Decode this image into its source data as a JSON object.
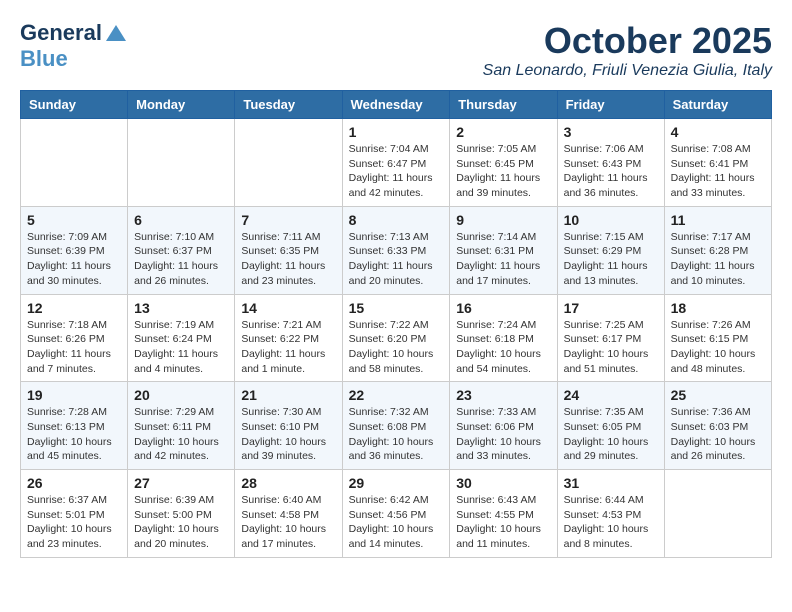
{
  "header": {
    "logo_general": "General",
    "logo_blue": "Blue",
    "month_title": "October 2025",
    "location": "San Leonardo, Friuli Venezia Giulia, Italy"
  },
  "days_of_week": [
    "Sunday",
    "Monday",
    "Tuesday",
    "Wednesday",
    "Thursday",
    "Friday",
    "Saturday"
  ],
  "weeks": [
    [
      {
        "day": "",
        "info": ""
      },
      {
        "day": "",
        "info": ""
      },
      {
        "day": "",
        "info": ""
      },
      {
        "day": "1",
        "info": "Sunrise: 7:04 AM\nSunset: 6:47 PM\nDaylight: 11 hours and 42 minutes."
      },
      {
        "day": "2",
        "info": "Sunrise: 7:05 AM\nSunset: 6:45 PM\nDaylight: 11 hours and 39 minutes."
      },
      {
        "day": "3",
        "info": "Sunrise: 7:06 AM\nSunset: 6:43 PM\nDaylight: 11 hours and 36 minutes."
      },
      {
        "day": "4",
        "info": "Sunrise: 7:08 AM\nSunset: 6:41 PM\nDaylight: 11 hours and 33 minutes."
      }
    ],
    [
      {
        "day": "5",
        "info": "Sunrise: 7:09 AM\nSunset: 6:39 PM\nDaylight: 11 hours and 30 minutes."
      },
      {
        "day": "6",
        "info": "Sunrise: 7:10 AM\nSunset: 6:37 PM\nDaylight: 11 hours and 26 minutes."
      },
      {
        "day": "7",
        "info": "Sunrise: 7:11 AM\nSunset: 6:35 PM\nDaylight: 11 hours and 23 minutes."
      },
      {
        "day": "8",
        "info": "Sunrise: 7:13 AM\nSunset: 6:33 PM\nDaylight: 11 hours and 20 minutes."
      },
      {
        "day": "9",
        "info": "Sunrise: 7:14 AM\nSunset: 6:31 PM\nDaylight: 11 hours and 17 minutes."
      },
      {
        "day": "10",
        "info": "Sunrise: 7:15 AM\nSunset: 6:29 PM\nDaylight: 11 hours and 13 minutes."
      },
      {
        "day": "11",
        "info": "Sunrise: 7:17 AM\nSunset: 6:28 PM\nDaylight: 11 hours and 10 minutes."
      }
    ],
    [
      {
        "day": "12",
        "info": "Sunrise: 7:18 AM\nSunset: 6:26 PM\nDaylight: 11 hours and 7 minutes."
      },
      {
        "day": "13",
        "info": "Sunrise: 7:19 AM\nSunset: 6:24 PM\nDaylight: 11 hours and 4 minutes."
      },
      {
        "day": "14",
        "info": "Sunrise: 7:21 AM\nSunset: 6:22 PM\nDaylight: 11 hours and 1 minute."
      },
      {
        "day": "15",
        "info": "Sunrise: 7:22 AM\nSunset: 6:20 PM\nDaylight: 10 hours and 58 minutes."
      },
      {
        "day": "16",
        "info": "Sunrise: 7:24 AM\nSunset: 6:18 PM\nDaylight: 10 hours and 54 minutes."
      },
      {
        "day": "17",
        "info": "Sunrise: 7:25 AM\nSunset: 6:17 PM\nDaylight: 10 hours and 51 minutes."
      },
      {
        "day": "18",
        "info": "Sunrise: 7:26 AM\nSunset: 6:15 PM\nDaylight: 10 hours and 48 minutes."
      }
    ],
    [
      {
        "day": "19",
        "info": "Sunrise: 7:28 AM\nSunset: 6:13 PM\nDaylight: 10 hours and 45 minutes."
      },
      {
        "day": "20",
        "info": "Sunrise: 7:29 AM\nSunset: 6:11 PM\nDaylight: 10 hours and 42 minutes."
      },
      {
        "day": "21",
        "info": "Sunrise: 7:30 AM\nSunset: 6:10 PM\nDaylight: 10 hours and 39 minutes."
      },
      {
        "day": "22",
        "info": "Sunrise: 7:32 AM\nSunset: 6:08 PM\nDaylight: 10 hours and 36 minutes."
      },
      {
        "day": "23",
        "info": "Sunrise: 7:33 AM\nSunset: 6:06 PM\nDaylight: 10 hours and 33 minutes."
      },
      {
        "day": "24",
        "info": "Sunrise: 7:35 AM\nSunset: 6:05 PM\nDaylight: 10 hours and 29 minutes."
      },
      {
        "day": "25",
        "info": "Sunrise: 7:36 AM\nSunset: 6:03 PM\nDaylight: 10 hours and 26 minutes."
      }
    ],
    [
      {
        "day": "26",
        "info": "Sunrise: 6:37 AM\nSunset: 5:01 PM\nDaylight: 10 hours and 23 minutes."
      },
      {
        "day": "27",
        "info": "Sunrise: 6:39 AM\nSunset: 5:00 PM\nDaylight: 10 hours and 20 minutes."
      },
      {
        "day": "28",
        "info": "Sunrise: 6:40 AM\nSunset: 4:58 PM\nDaylight: 10 hours and 17 minutes."
      },
      {
        "day": "29",
        "info": "Sunrise: 6:42 AM\nSunset: 4:56 PM\nDaylight: 10 hours and 14 minutes."
      },
      {
        "day": "30",
        "info": "Sunrise: 6:43 AM\nSunset: 4:55 PM\nDaylight: 10 hours and 11 minutes."
      },
      {
        "day": "31",
        "info": "Sunrise: 6:44 AM\nSunset: 4:53 PM\nDaylight: 10 hours and 8 minutes."
      },
      {
        "day": "",
        "info": ""
      }
    ]
  ]
}
